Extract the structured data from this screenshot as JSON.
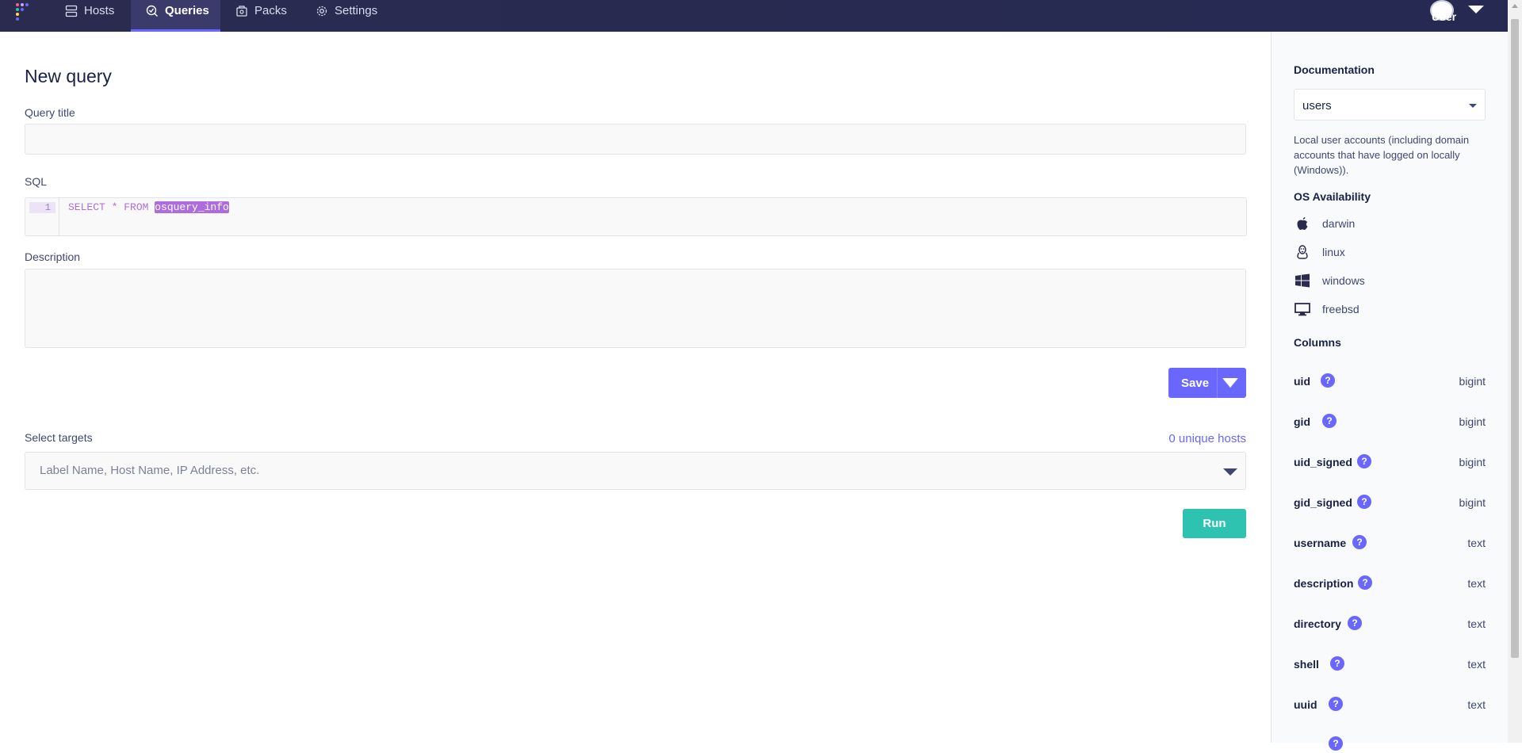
{
  "nav": {
    "items": [
      {
        "label": "Hosts",
        "icon": "hosts-icon"
      },
      {
        "label": "Queries",
        "icon": "queries-icon"
      },
      {
        "label": "Packs",
        "icon": "packs-icon"
      },
      {
        "label": "Settings",
        "icon": "settings-icon"
      }
    ],
    "active": "Queries",
    "user_label": "User"
  },
  "form": {
    "page_title": "New query",
    "query_title_label": "Query title",
    "query_title_value": "",
    "sql_label": "SQL",
    "sql_line_number": "1",
    "sql_keywords": "SELECT * FROM ",
    "sql_table": "osquery_info",
    "description_label": "Description",
    "description_value": "",
    "save_label": "Save",
    "targets_label": "Select targets",
    "unique_hosts": "0 unique hosts",
    "targets_placeholder": "Label Name, Host Name, IP Address, etc.",
    "run_label": "Run"
  },
  "sidebar": {
    "documentation_heading": "Documentation",
    "selected_table": "users",
    "table_description": "Local user accounts (including domain accounts that have logged on locally (Windows)).",
    "os_heading": "OS Availability",
    "os": [
      "darwin",
      "linux",
      "windows",
      "freebsd"
    ],
    "columns_heading": "Columns",
    "columns": [
      {
        "name": "uid",
        "type": "bigint"
      },
      {
        "name": "gid",
        "type": "bigint"
      },
      {
        "name": "uid_signed",
        "type": "bigint"
      },
      {
        "name": "gid_signed",
        "type": "bigint"
      },
      {
        "name": "username",
        "type": "text"
      },
      {
        "name": "description",
        "type": "text"
      },
      {
        "name": "directory",
        "type": "text"
      },
      {
        "name": "shell",
        "type": "text"
      },
      {
        "name": "uuid",
        "type": "text"
      }
    ],
    "help_glyph": "?"
  },
  "colors": {
    "nav_bg": "#2a2b4f",
    "accent": "#6a67fe",
    "run": "#2ec3b1",
    "sql": "#ae6ddf"
  }
}
